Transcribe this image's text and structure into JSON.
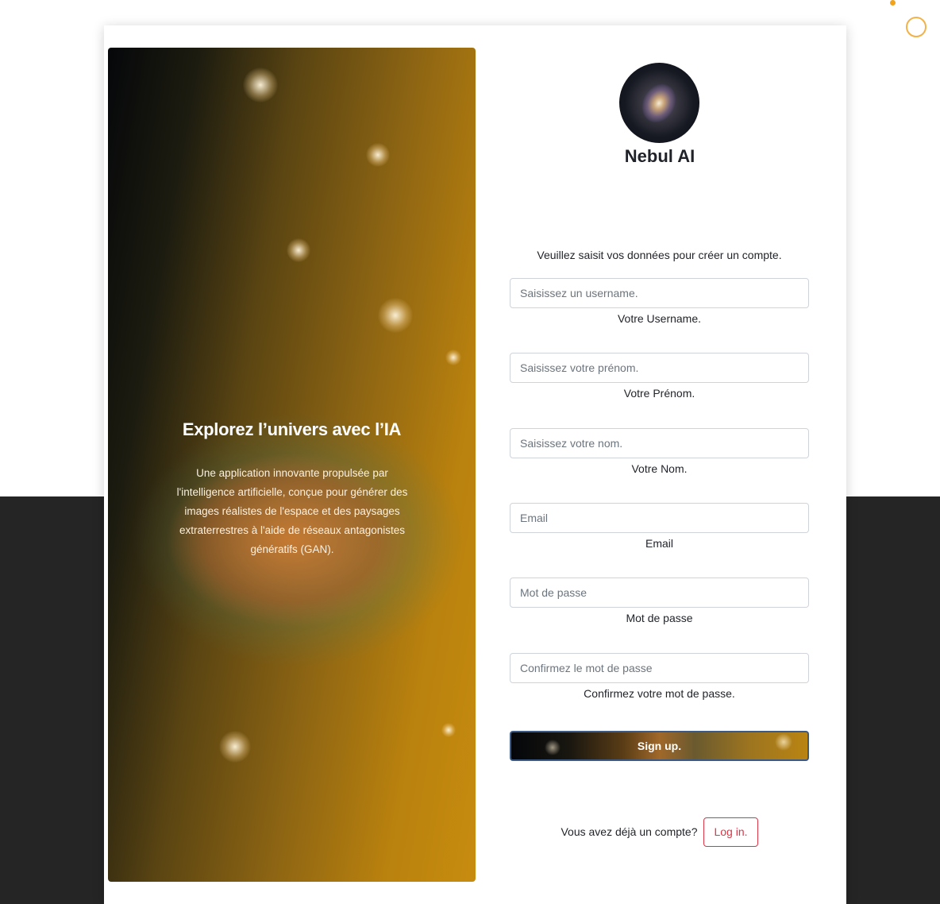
{
  "brand": {
    "name": "Nebul AI"
  },
  "hero": {
    "title": "Explorez l’univers avec l’IA",
    "description": "Une application innovante propulsée par l'intelligence artificielle, conçue pour générer des images réalistes de l'espace et des paysages extraterrestres à l'aide de réseaux antagonistes génératifs (GAN)."
  },
  "form": {
    "intro": "Veuillez saisit vos données pour créer un compte.",
    "fields": [
      {
        "placeholder": "Saisissez un username.",
        "help": "Votre Username."
      },
      {
        "placeholder": "Saisissez votre prénom.",
        "help": "Votre Prénom."
      },
      {
        "placeholder": "Saisissez votre nom.",
        "help": "Votre Nom."
      },
      {
        "placeholder": "Email",
        "help": "Email"
      },
      {
        "placeholder": "Mot de passe",
        "help": "Mot de passe"
      },
      {
        "placeholder": "Confirmez le mot de passe",
        "help": "Confirmez votre mot de passe."
      }
    ],
    "submit_label": "Sign up.",
    "login_prompt": "Vous avez déjà un compte?",
    "login_label": "Log in."
  },
  "colors": {
    "accent_orange": "#f2a31a",
    "dark_band": "#252525",
    "login_red": "#dc3545"
  }
}
